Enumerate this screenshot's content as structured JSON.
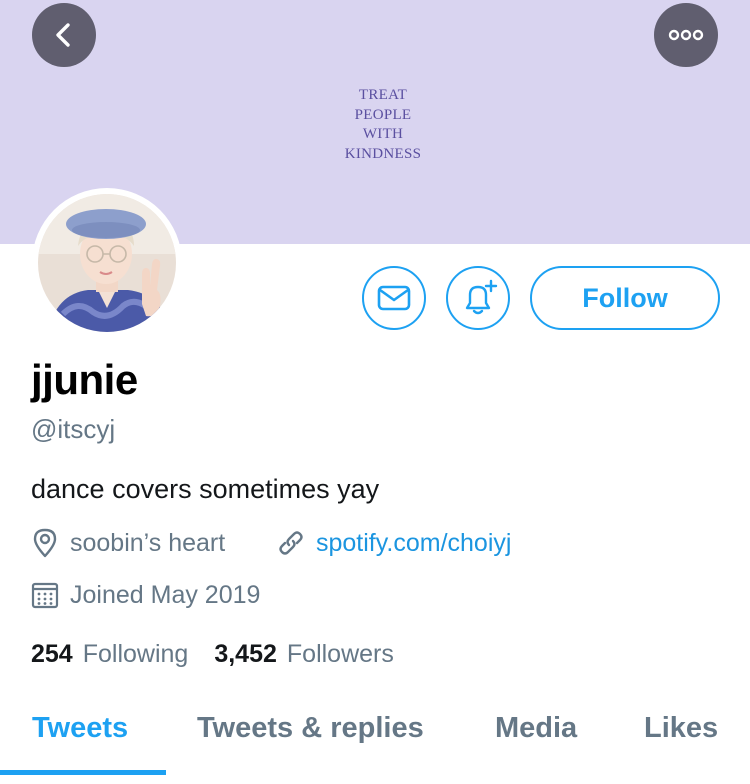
{
  "banner": {
    "lines": [
      "TREAT",
      "PEOPLE",
      "WITH",
      "KINDNESS"
    ],
    "bg_color": "#d9d4f0"
  },
  "nav": {
    "back_icon": "chevron-left-icon",
    "more_icon": "ellipsis-icon"
  },
  "actions": {
    "message_icon": "envelope-icon",
    "notify_icon": "bell-plus-icon",
    "follow_label": "Follow"
  },
  "profile": {
    "display_name": "jjunie",
    "handle": "@itscyj",
    "bio": "dance covers sometimes yay",
    "location": "soobin’s heart",
    "website": "spotify.com/choiyj",
    "joined": "Joined May 2019"
  },
  "stats": {
    "following_count": "254",
    "following_label": "Following",
    "followers_count": "3,452",
    "followers_label": "Followers"
  },
  "tabs": [
    {
      "label": "Tweets",
      "active": true
    },
    {
      "label": "Tweets & replies",
      "active": false
    },
    {
      "label": "Media",
      "active": false
    },
    {
      "label": "Likes",
      "active": false
    }
  ],
  "colors": {
    "accent": "#1da1f2",
    "link": "#1b95e0",
    "secondary_text": "#657786",
    "primary_text": "#14171a"
  }
}
